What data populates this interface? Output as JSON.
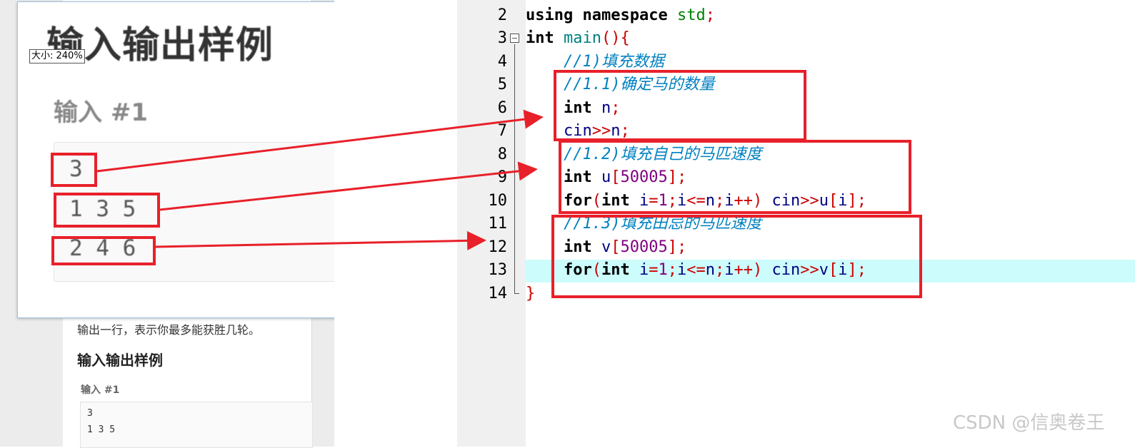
{
  "background_page": {
    "description_line": "输出一行，表示你最多能获胜几轮。",
    "heading": "输入输出样例",
    "sub_heading": "输入 #1",
    "sample_lines": [
      "3",
      "1 3 5"
    ]
  },
  "zoom_popup": {
    "title": "输入输出样例",
    "size_label": "大小: 240%",
    "sub_heading": "输入 #1",
    "lines": [
      "3",
      "1 3 5",
      "2 4 6"
    ]
  },
  "editor": {
    "line_numbers": [
      "2",
      "3",
      "4",
      "5",
      "6",
      "7",
      "8",
      "9",
      "10",
      "11",
      "12",
      "13",
      "14"
    ],
    "highlighted_line": "13",
    "comments": {
      "c1": "//1)填充数据",
      "c11": "//1.1)确定马的数量",
      "c12": "//1.2)填充自己的马匹速度",
      "c13": "//1.3)填充田忌的马匹速度"
    },
    "tokens": {
      "using": "using",
      "namespace": "namespace",
      "std": "std",
      "int": "int",
      "main": "main",
      "n": "n",
      "cin": "cin",
      "u": "u",
      "v": "v",
      "for": "for",
      "i": "i",
      "size": "50005",
      "one": "1"
    }
  },
  "annotation_colors": {
    "box": "#e8202a",
    "arrow": "#e8202a"
  },
  "watermark": "CSDN @信奥卷王"
}
